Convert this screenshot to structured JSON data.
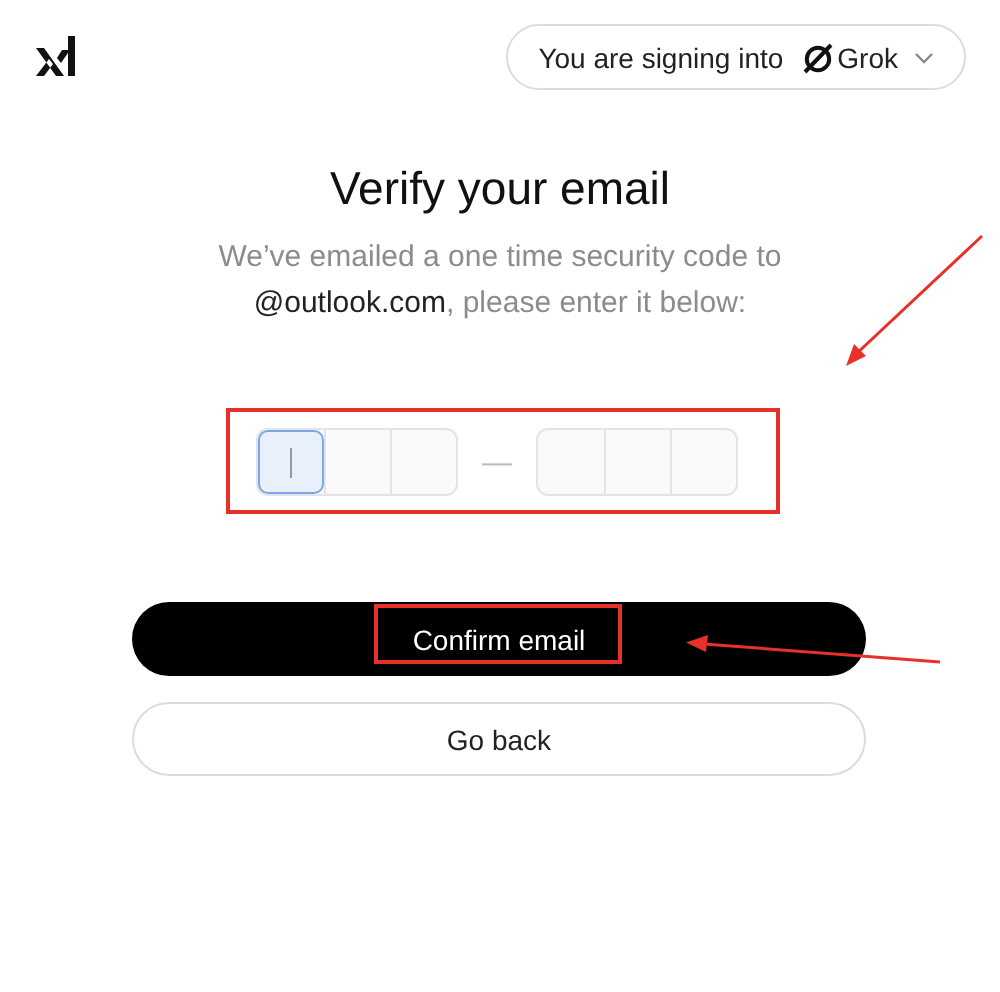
{
  "header": {
    "signing_label": "You are signing into",
    "app_name": "Grok"
  },
  "title": "Verify your email",
  "message": "We’ve emailed a one time security code to **@outlook.com**, please enter it below:",
  "code_input": {
    "highlighted": true,
    "pointed_at": true,
    "separator": "—",
    "groups": [
      {
        "cells": [
          {
            "focused": true
          },
          {
            "focused": false
          },
          {
            "focused": false
          }
        ]
      },
      {
        "cells": [
          {
            "focused": false
          },
          {
            "focused": false
          },
          {
            "focused": false
          }
        ]
      }
    ]
  },
  "buttons": [
    {
      "kind": "primary",
      "label": "Confirm email",
      "highlighted": true,
      "pointed_at": true
    },
    {
      "kind": "secondary",
      "label": "Go back",
      "highlighted": false,
      "pointed_at": false
    }
  ]
}
